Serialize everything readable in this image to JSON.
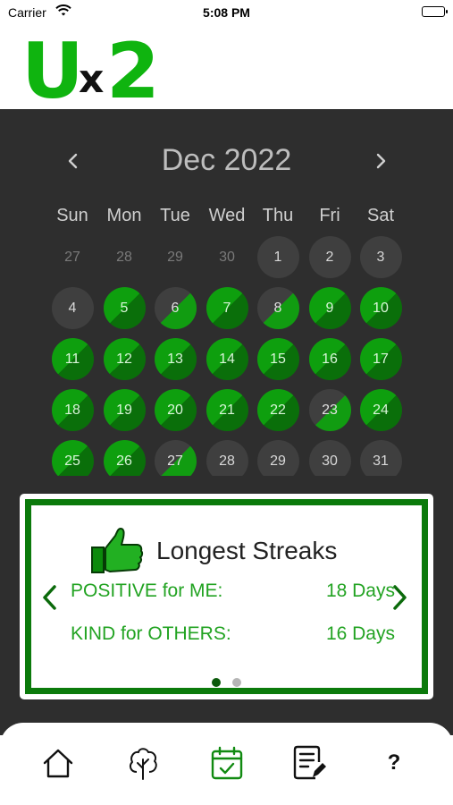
{
  "status_bar": {
    "carrier": "Carrier",
    "time": "5:08 PM"
  },
  "logo": {
    "u": "U",
    "x": "x",
    "two": "2",
    "colors": {
      "green": "#0fb40f",
      "dark": "#111111"
    }
  },
  "calendar": {
    "month_title": "Dec 2022",
    "weekdays": [
      "Sun",
      "Mon",
      "Tue",
      "Wed",
      "Thu",
      "Fri",
      "Sat"
    ],
    "days": [
      {
        "label": "27",
        "state": "muted"
      },
      {
        "label": "28",
        "state": "muted"
      },
      {
        "label": "29",
        "state": "muted"
      },
      {
        "label": "30",
        "state": "muted"
      },
      {
        "label": "1",
        "state": "plain"
      },
      {
        "label": "2",
        "state": "plain"
      },
      {
        "label": "3",
        "state": "plain"
      },
      {
        "label": "4",
        "state": "plain"
      },
      {
        "label": "5",
        "state": "full"
      },
      {
        "label": "6",
        "state": "half"
      },
      {
        "label": "7",
        "state": "full"
      },
      {
        "label": "8",
        "state": "half"
      },
      {
        "label": "9",
        "state": "full"
      },
      {
        "label": "10",
        "state": "full"
      },
      {
        "label": "11",
        "state": "full"
      },
      {
        "label": "12",
        "state": "full"
      },
      {
        "label": "13",
        "state": "full"
      },
      {
        "label": "14",
        "state": "full"
      },
      {
        "label": "15",
        "state": "full"
      },
      {
        "label": "16",
        "state": "full"
      },
      {
        "label": "17",
        "state": "full"
      },
      {
        "label": "18",
        "state": "full"
      },
      {
        "label": "19",
        "state": "full"
      },
      {
        "label": "20",
        "state": "full"
      },
      {
        "label": "21",
        "state": "full"
      },
      {
        "label": "22",
        "state": "full"
      },
      {
        "label": "23",
        "state": "half"
      },
      {
        "label": "24",
        "state": "full"
      },
      {
        "label": "25",
        "state": "full"
      },
      {
        "label": "26",
        "state": "full"
      },
      {
        "label": "27",
        "state": "half"
      },
      {
        "label": "28",
        "state": "plain"
      },
      {
        "label": "29",
        "state": "plain"
      },
      {
        "label": "30",
        "state": "plain"
      },
      {
        "label": "31",
        "state": "plain"
      }
    ]
  },
  "streaks": {
    "title": "Longest Streaks",
    "rows": [
      {
        "label": "POSITIVE for ME:",
        "value": "18 Days"
      },
      {
        "label": "KIND for OTHERS:",
        "value": "16 Days"
      }
    ],
    "page_count": 2,
    "active_page": 1
  },
  "tabs": [
    {
      "name": "home",
      "icon": "home-icon",
      "active": false
    },
    {
      "name": "growth",
      "icon": "tree-icon",
      "active": false
    },
    {
      "name": "calendar",
      "icon": "calendar-check-icon",
      "active": true
    },
    {
      "name": "journal",
      "icon": "note-edit-icon",
      "active": false
    },
    {
      "name": "help",
      "icon": "question-icon",
      "label": "?",
      "active": false
    }
  ],
  "colors": {
    "panel_bg": "#2e2e2e",
    "accent_green": "#22a322",
    "card_border": "#0b7a0b"
  }
}
